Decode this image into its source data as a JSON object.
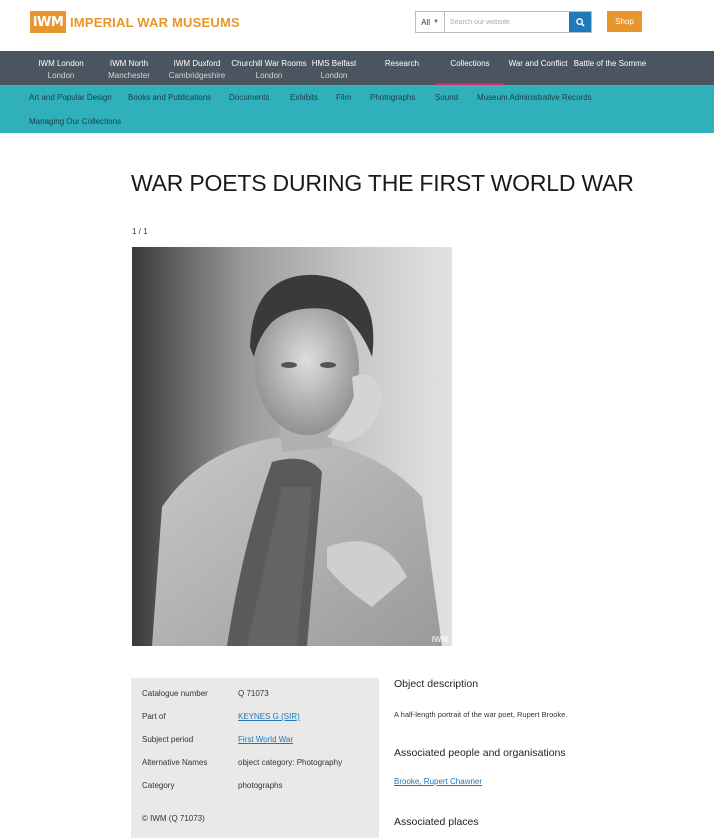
{
  "header": {
    "logo_mark": "IWM",
    "logo_text": "IMPERIAL WAR MUSEUMS",
    "search_scope": "All",
    "search_placeholder": "Search our website",
    "shop_label": "Shop"
  },
  "nav": [
    {
      "label": "IWM London",
      "sub": "London"
    },
    {
      "label": "IWM North",
      "sub": "Manchester"
    },
    {
      "label": "IWM Duxford",
      "sub": "Cambridgeshire"
    },
    {
      "label": "Churchill War Rooms",
      "sub": "London"
    },
    {
      "label": "HMS Belfast",
      "sub": "London"
    },
    {
      "label": "Research",
      "sub": ""
    },
    {
      "label": "Collections",
      "sub": ""
    },
    {
      "label": "War and Conflict",
      "sub": ""
    },
    {
      "label": "Battle of the Somme",
      "sub": ""
    }
  ],
  "subnav": [
    "Art and Popular Design",
    "Books and Publications",
    "Documents",
    "Exhibits",
    "Film",
    "Photographs",
    "Sound",
    "Museum Administrative Records",
    "Managing Our Collections"
  ],
  "page": {
    "title": "WAR POETS DURING THE FIRST WORLD WAR",
    "counter": "1 / 1",
    "watermark": "IWM"
  },
  "details": {
    "rows": [
      {
        "label": "Catalogue number",
        "value": "Q 71073"
      },
      {
        "label": "Part of",
        "value": "KEYNES G (SIR)"
      },
      {
        "label": "Subject period",
        "value": "First World War"
      },
      {
        "label": "Alternative Names",
        "value": "object category: Photography"
      },
      {
        "label": "Category",
        "value": "photographs"
      }
    ],
    "copyright": "© IWM (Q 71073)"
  },
  "description": {
    "heading": "Object description",
    "text": "A half-length portrait of the war poet, Rupert Brooke.",
    "people_heading": "Associated people and organisations",
    "people_link": "Brooke, Rupert Chawner",
    "places_heading": "Associated places"
  },
  "colors": {
    "brand_orange": "#e8962b",
    "nav_dark": "#4a5560",
    "subnav_teal": "#2fb0ba",
    "active_underline": "#e8216b",
    "link_blue": "#1f78b7"
  }
}
